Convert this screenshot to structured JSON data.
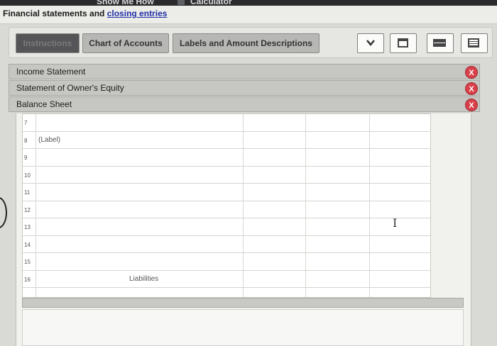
{
  "topbar": {
    "show_me_how": "Show Me How",
    "calculator": "Calculator"
  },
  "header": {
    "title": "Financial statements and",
    "title_link": "closing entries"
  },
  "tabs": [
    {
      "label": "Instructions"
    },
    {
      "label": "Chart of Accounts"
    },
    {
      "label": "Labels and Amount Descriptions"
    }
  ],
  "toolbar": {
    "dropdown_icon": "chevron-down-icon",
    "view_icons": [
      "window-icon",
      "split-view-icon",
      "list-view-icon"
    ]
  },
  "sections": [
    {
      "label": "Income Statement"
    },
    {
      "label": "Statement of Owner's Equity"
    },
    {
      "label": "Balance Sheet"
    }
  ],
  "close_glyph": "X",
  "sheet": {
    "rows": [
      "7",
      "8",
      "9",
      "10",
      "11",
      "12",
      "13",
      "14",
      "15",
      "16"
    ],
    "cell_label": "(Label)",
    "cell_liabilities": "Liabilities"
  },
  "colors": {
    "close": "#d8404a",
    "section_bar": "#c6c6c2",
    "title_link": "#2030a8"
  }
}
